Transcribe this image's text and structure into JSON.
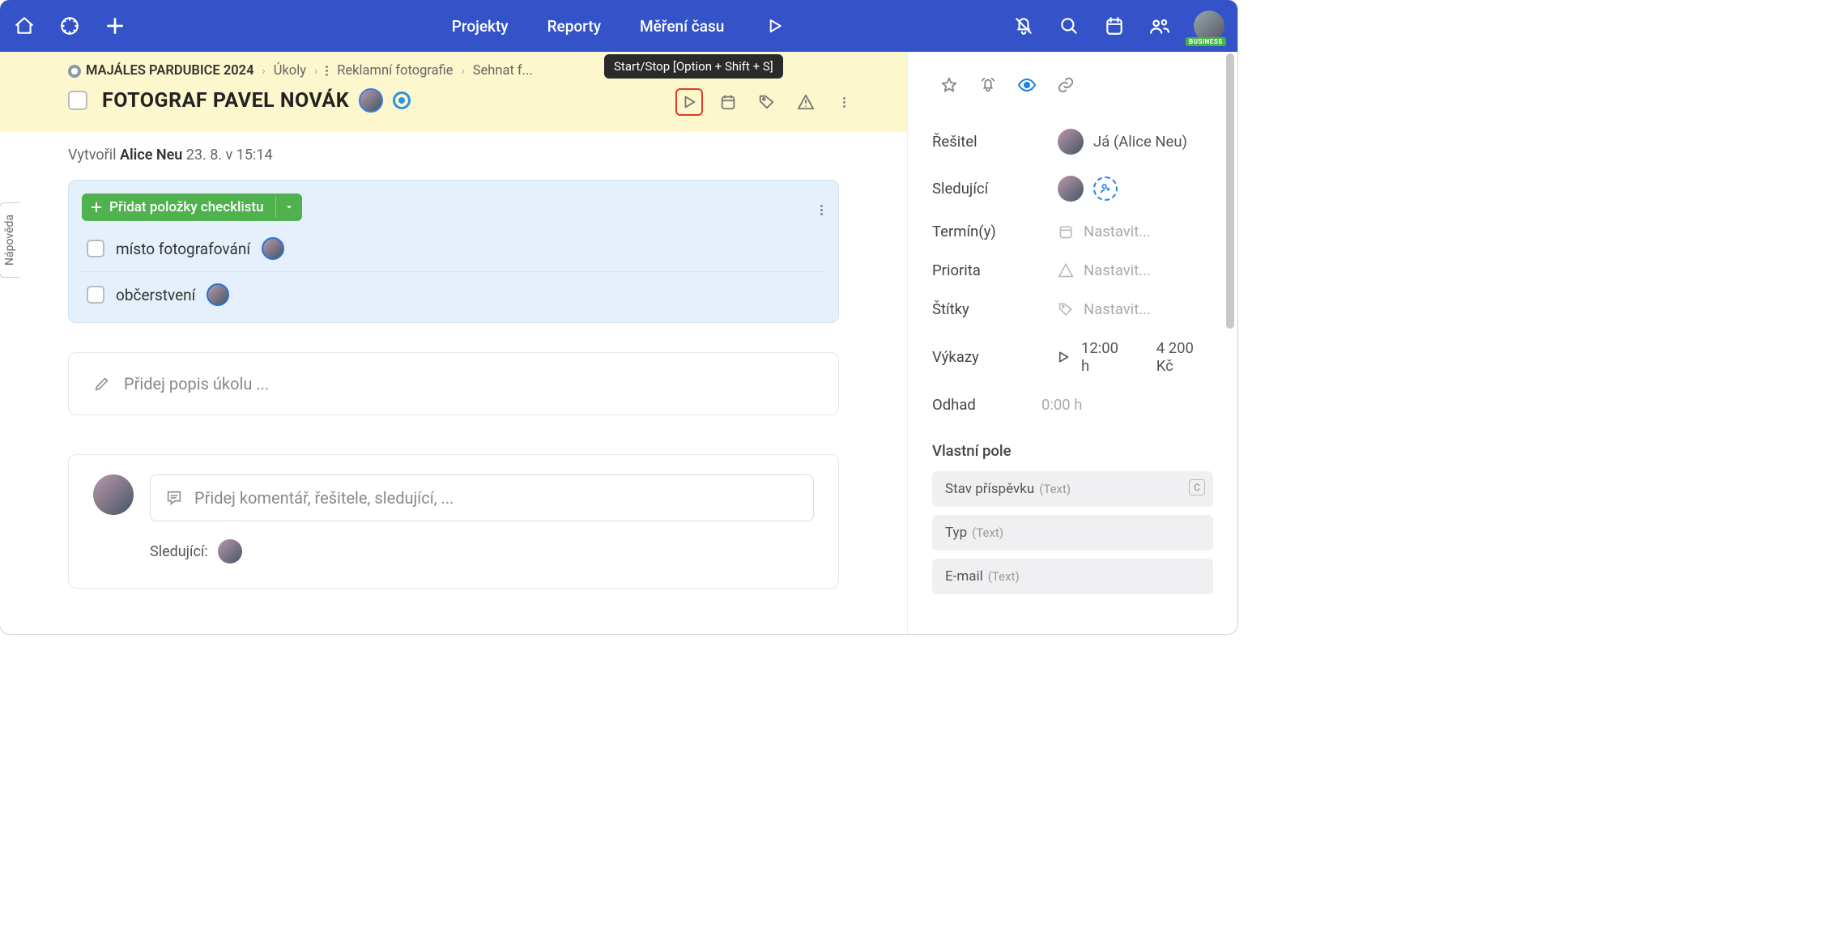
{
  "nav": {
    "items": [
      "Projekty",
      "Reporty",
      "Měření času"
    ],
    "badge": "BUSINESS"
  },
  "help_tab": "Nápověda",
  "breadcrumb": {
    "project": "MAJÁLES PARDUBICE 2024",
    "l1": "Úkoly",
    "l2": "Reklamní fotografie",
    "l3": "Sehnat f..."
  },
  "task": {
    "title": "FOTOGRAF PAVEL NOVÁK",
    "creator_prefix": "Vytvořil ",
    "creator": "Alice Neu",
    "created_at": " 23. 8. v 15:14"
  },
  "tooltip": "Start/Stop [Option + Shift + S]",
  "checklist": {
    "add_label": "Přidat položky checklistu",
    "items": [
      "místo fotografování",
      "občerstvení"
    ]
  },
  "description_placeholder": "Přidej popis úkolu ...",
  "comment": {
    "placeholder": "Přidej komentář, řešitele, sledující, ...",
    "followers_label": "Sledující:"
  },
  "side": {
    "assignee_lbl": "Řešitel",
    "assignee_val": "Já (Alice Neu)",
    "followers_lbl": "Sledující",
    "dates_lbl": "Termín(y)",
    "priority_lbl": "Priorita",
    "tags_lbl": "Štítky",
    "set_placeholder": "Nastavit...",
    "reports_lbl": "Výkazy",
    "reports_time": "12:00 h",
    "reports_money": "4 200 Kč",
    "estimate_lbl": "Odhad",
    "estimate_val": "0:00 h",
    "custom_heading": "Vlastní pole",
    "cf": [
      {
        "name": "Stav příspěvku",
        "type": "(Text)",
        "badge": "C"
      },
      {
        "name": "Typ",
        "type": "(Text)"
      },
      {
        "name": "E-mail",
        "type": "(Text)"
      }
    ]
  }
}
